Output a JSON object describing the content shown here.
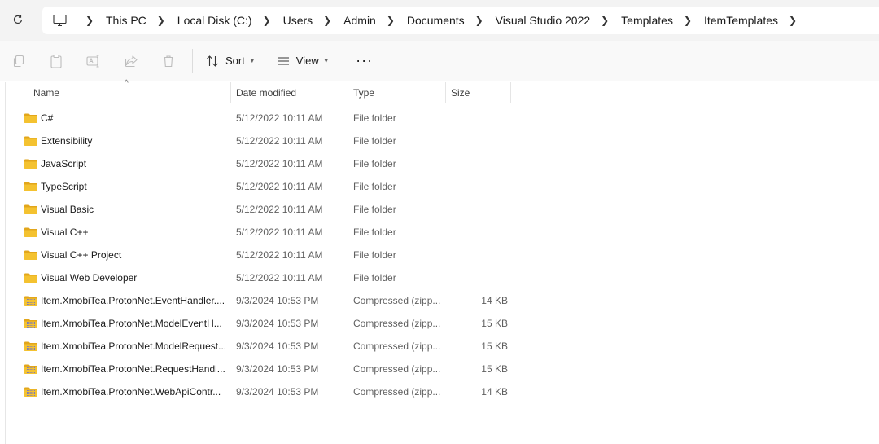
{
  "address_bar": {
    "breadcrumbs": [
      "This PC",
      "Local Disk (C:)",
      "Users",
      "Admin",
      "Documents",
      "Visual Studio 2022",
      "Templates",
      "ItemTemplates"
    ]
  },
  "command_bar": {
    "sort_label": "Sort",
    "view_label": "View",
    "more_label": "···"
  },
  "columns": {
    "name": "Name",
    "date": "Date modified",
    "type": "Type",
    "size": "Size"
  },
  "files": [
    {
      "name": "C#",
      "date": "5/12/2022 10:11 AM",
      "type": "File folder",
      "size": "",
      "kind": "folder"
    },
    {
      "name": "Extensibility",
      "date": "5/12/2022 10:11 AM",
      "type": "File folder",
      "size": "",
      "kind": "folder"
    },
    {
      "name": "JavaScript",
      "date": "5/12/2022 10:11 AM",
      "type": "File folder",
      "size": "",
      "kind": "folder"
    },
    {
      "name": "TypeScript",
      "date": "5/12/2022 10:11 AM",
      "type": "File folder",
      "size": "",
      "kind": "folder"
    },
    {
      "name": "Visual Basic",
      "date": "5/12/2022 10:11 AM",
      "type": "File folder",
      "size": "",
      "kind": "folder"
    },
    {
      "name": "Visual C++",
      "date": "5/12/2022 10:11 AM",
      "type": "File folder",
      "size": "",
      "kind": "folder"
    },
    {
      "name": "Visual C++ Project",
      "date": "5/12/2022 10:11 AM",
      "type": "File folder",
      "size": "",
      "kind": "folder"
    },
    {
      "name": "Visual Web Developer",
      "date": "5/12/2022 10:11 AM",
      "type": "File folder",
      "size": "",
      "kind": "folder"
    },
    {
      "name": "Item.XmobiTea.ProtonNet.EventHandler....",
      "date": "9/3/2024 10:53 PM",
      "type": "Compressed (zipp...",
      "size": "14 KB",
      "kind": "zip"
    },
    {
      "name": "Item.XmobiTea.ProtonNet.ModelEventH...",
      "date": "9/3/2024 10:53 PM",
      "type": "Compressed (zipp...",
      "size": "15 KB",
      "kind": "zip"
    },
    {
      "name": "Item.XmobiTea.ProtonNet.ModelRequest...",
      "date": "9/3/2024 10:53 PM",
      "type": "Compressed (zipp...",
      "size": "15 KB",
      "kind": "zip"
    },
    {
      "name": "Item.XmobiTea.ProtonNet.RequestHandl...",
      "date": "9/3/2024 10:53 PM",
      "type": "Compressed (zipp...",
      "size": "15 KB",
      "kind": "zip"
    },
    {
      "name": "Item.XmobiTea.ProtonNet.WebApiContr...",
      "date": "9/3/2024 10:53 PM",
      "type": "Compressed (zipp...",
      "size": "14 KB",
      "kind": "zip"
    }
  ],
  "colors": {
    "folder": "#f4c230",
    "folder_dark": "#e2a61b",
    "zip_stripe": "#7b7bb8"
  }
}
